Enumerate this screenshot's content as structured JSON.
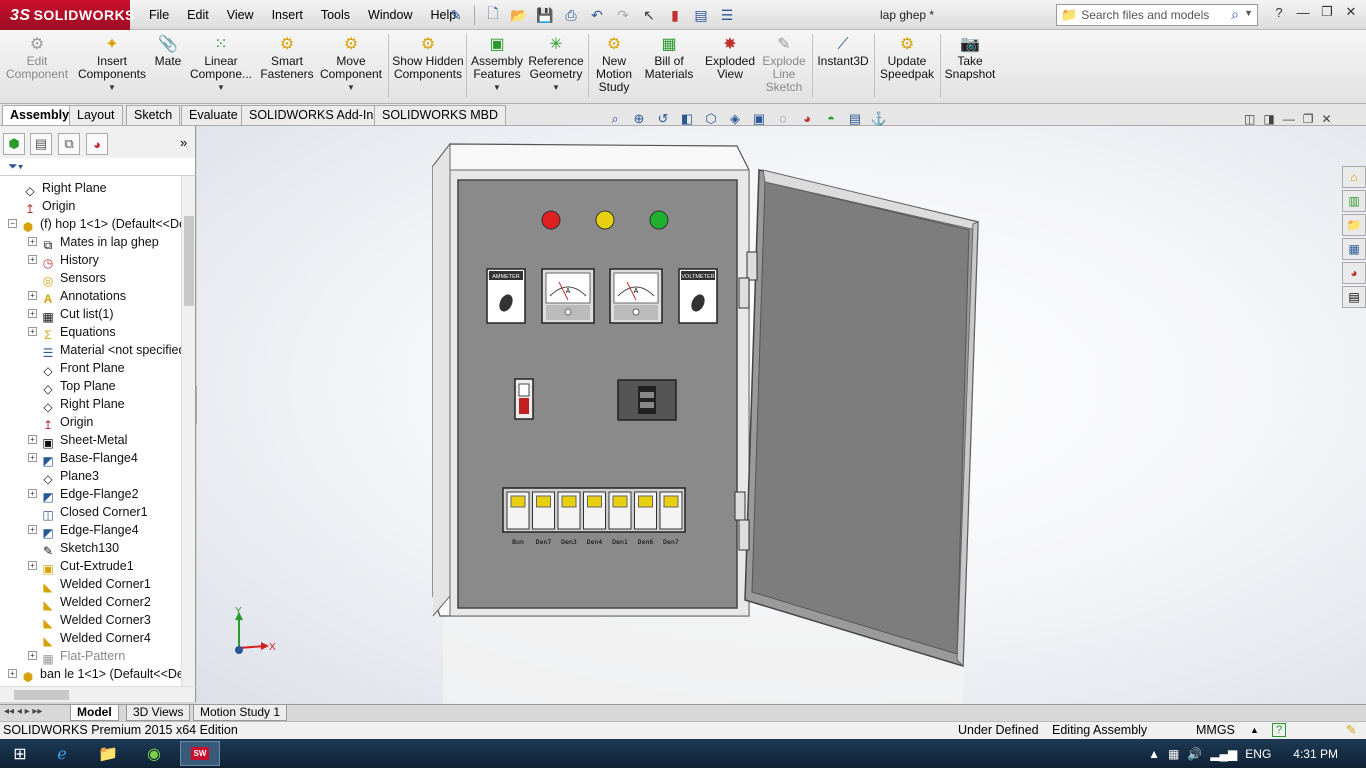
{
  "app": {
    "logo_ds": "3S",
    "logo_text": "SOLIDWORKS",
    "doc_title": "lap ghep *"
  },
  "menus": [
    "File",
    "Edit",
    "View",
    "Insert",
    "Tools",
    "Window",
    "Help"
  ],
  "search": {
    "placeholder": "Search files and models"
  },
  "commands": [
    {
      "label": "Edit Component",
      "disabled": true
    },
    {
      "label": "Insert Components"
    },
    {
      "label": "Mate"
    },
    {
      "label": "Linear Compone..."
    },
    {
      "label": "Smart Fasteners"
    },
    {
      "label": "Move Component"
    },
    {
      "label": "Show Hidden Components"
    },
    {
      "label": "Assembly Features"
    },
    {
      "label": "Reference Geometry"
    },
    {
      "label": "New Motion Study"
    },
    {
      "label": "Bill of Materials"
    },
    {
      "label": "Exploded View"
    },
    {
      "label": "Explode Line Sketch",
      "disabled": true
    },
    {
      "label": "Instant3D"
    },
    {
      "label": "Update Speedpak"
    },
    {
      "label": "Take Snapshot"
    }
  ],
  "tabs": [
    "Assembly",
    "Layout",
    "Sketch",
    "Evaluate",
    "SOLIDWORKS Add-Ins",
    "SOLIDWORKS MBD"
  ],
  "tree": [
    {
      "label": "Right Plane",
      "icon": "plane-icon"
    },
    {
      "label": "Origin",
      "icon": "origin-icon"
    },
    {
      "label": "(f) hop 1<1> (Default<<De",
      "icon": "part-icon"
    },
    {
      "label": "Mates in lap ghep",
      "icon": "mates-icon"
    },
    {
      "label": "History",
      "icon": "history-icon"
    },
    {
      "label": "Sensors",
      "icon": "sensor-icon"
    },
    {
      "label": "Annotations",
      "icon": "annotation-icon"
    },
    {
      "label": "Cut list(1)",
      "icon": "cutlist-icon"
    },
    {
      "label": "Equations",
      "icon": "equation-icon"
    },
    {
      "label": "Material <not specified>",
      "icon": "material-icon"
    },
    {
      "label": "Front Plane",
      "icon": "plane-icon"
    },
    {
      "label": "Top Plane",
      "icon": "plane-icon"
    },
    {
      "label": "Right Plane",
      "icon": "plane-icon"
    },
    {
      "label": "Origin",
      "icon": "origin-icon"
    },
    {
      "label": "Sheet-Metal",
      "icon": "sheetmetal-icon"
    },
    {
      "label": "Base-Flange4",
      "icon": "flange-icon"
    },
    {
      "label": "Plane3",
      "icon": "plane-icon"
    },
    {
      "label": "Edge-Flange2",
      "icon": "flange-icon"
    },
    {
      "label": "Closed Corner1",
      "icon": "corner-icon"
    },
    {
      "label": "Edge-Flange4",
      "icon": "flange-icon"
    },
    {
      "label": "Sketch130",
      "icon": "sketch-icon"
    },
    {
      "label": "Cut-Extrude1",
      "icon": "cut-icon"
    },
    {
      "label": "Welded Corner1",
      "icon": "weld-icon"
    },
    {
      "label": "Welded Corner2",
      "icon": "weld-icon"
    },
    {
      "label": "Welded Corner3",
      "icon": "weld-icon"
    },
    {
      "label": "Welded Corner4",
      "icon": "weld-icon"
    },
    {
      "label": "Flat-Pattern",
      "icon": "flatpattern-icon",
      "gray": true
    },
    {
      "label": "ban le 1<1> (Default<<De",
      "icon": "part-icon"
    }
  ],
  "cabinet": {
    "meter_labels": [
      "AMMETER",
      "A",
      "A",
      "VOLTMETER"
    ],
    "breaker_labels": [
      "Bun",
      "Den7",
      "Den3",
      "Den4",
      "Den1",
      "Den6",
      "Den7"
    ],
    "lamp_colors": [
      "#e02020",
      "#e8d010",
      "#20b030"
    ]
  },
  "triad": {
    "y": "Y",
    "x": "X"
  },
  "bottom_tabs": [
    "Model",
    "3D Views",
    "Motion Study 1"
  ],
  "status": {
    "edition": "SOLIDWORKS Premium 2015 x64 Edition",
    "state": "Under Defined",
    "mode": "Editing Assembly",
    "units": "MMGS",
    "help": "?"
  },
  "taskbar": {
    "lang": "ENG",
    "time": "4:31 PM"
  }
}
